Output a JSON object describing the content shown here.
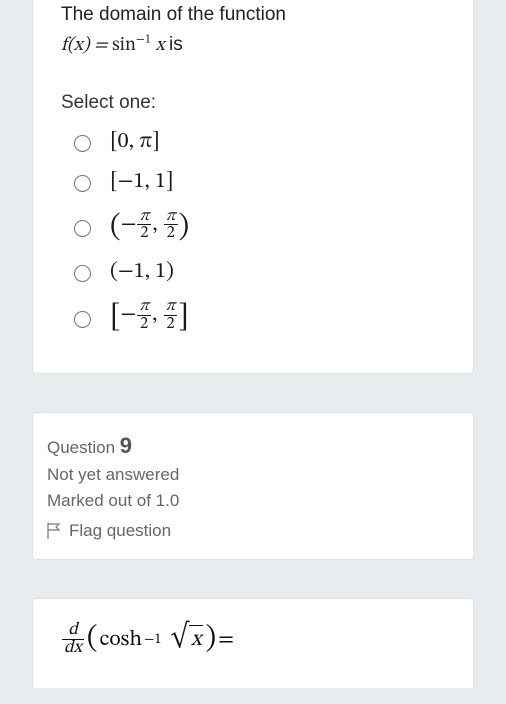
{
  "question1": {
    "prompt_prefix": "The domain of the function",
    "prompt_suffix": " is",
    "func_lhs": "f(x) = ",
    "func_fn": "sin",
    "func_exp": "−1",
    "func_arg": " x",
    "select_one": "Select one:",
    "options": [
      {
        "display": "[0, π]"
      },
      {
        "display": "[−1, 1]"
      },
      {
        "display": "open_pi_halves"
      },
      {
        "display": "(−1, 1)"
      },
      {
        "display": "closed_pi_halves"
      }
    ]
  },
  "infoCard": {
    "question_label": "Question",
    "question_number": "9",
    "status": "Not yet answered",
    "marks": "Marked out of 1.0",
    "flag": "Flag question"
  },
  "question2": {
    "deriv_num": "d",
    "deriv_den": "dx",
    "open_paren": "(",
    "fn": "cosh",
    "exp": "−1",
    "radicand": "x",
    "close_paren": ")",
    "equals": " = "
  }
}
